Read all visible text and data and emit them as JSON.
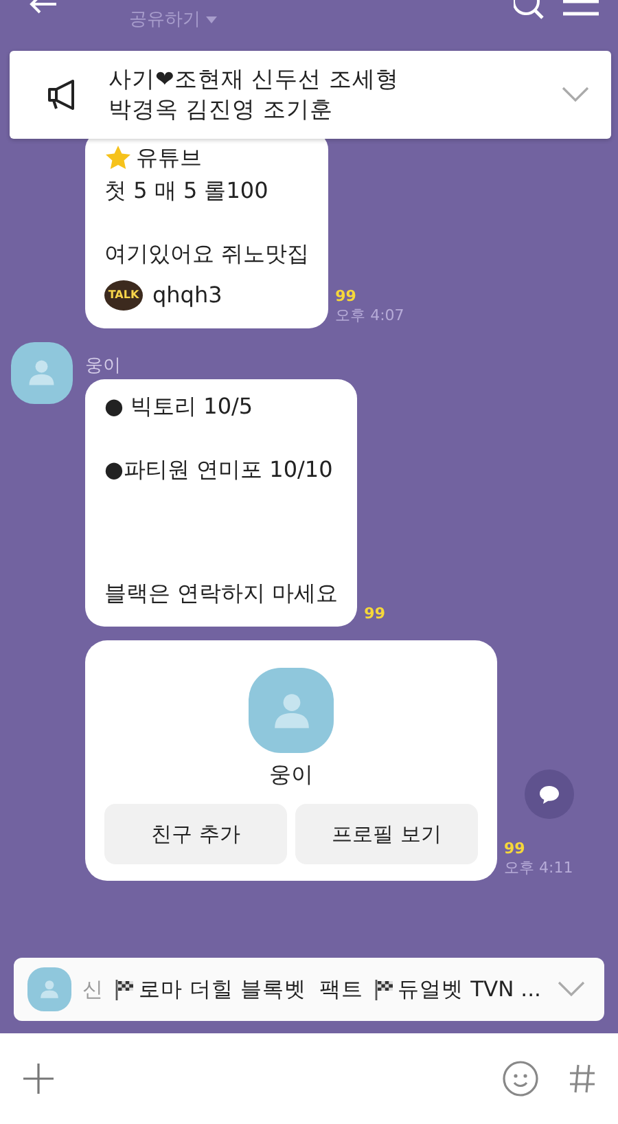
{
  "header": {
    "subtitle": "공유하기"
  },
  "notice": {
    "lines": [
      "사기❤조현재 신두선 조세형",
      "박경옥 김진영 조기훈"
    ]
  },
  "messages": [
    {
      "kind": "bubble",
      "lines": [
        {
          "kind": "star",
          "text": "유튜브"
        },
        {
          "kind": "text",
          "text": "첫 5 매 5 롤100"
        },
        {
          "kind": "gap"
        },
        {
          "kind": "text",
          "text": "여기있어요 쥐노맛집"
        },
        {
          "kind": "talk",
          "badge": "TALK",
          "text": "qhqh3"
        }
      ],
      "read": "99",
      "time": "오후 4:07"
    },
    {
      "kind": "bubble",
      "sender": "웅이",
      "lines": [
        {
          "kind": "text",
          "text": "● 빅토리  10/5"
        },
        {
          "kind": "gap"
        },
        {
          "kind": "text",
          "text": "●파티원 연미포 10/10"
        },
        {
          "kind": "gap"
        },
        {
          "kind": "gap"
        },
        {
          "kind": "gap"
        },
        {
          "kind": "text",
          "text": "블랙은 연락하지 마세요"
        }
      ],
      "read": "99"
    },
    {
      "kind": "profile",
      "name": "웅이",
      "buttons": [
        "친구 추가",
        "프로필 보기"
      ],
      "read": "99",
      "time": "오후 4:11"
    }
  ],
  "preview": {
    "sender": "신",
    "segments": [
      {
        "kind": "flag"
      },
      {
        "kind": "text",
        "text": "로마 더힐 블록벳  팩트 "
      },
      {
        "kind": "flag"
      },
      {
        "kind": "text",
        "text": "듀얼벳 TVN ..."
      }
    ]
  }
}
